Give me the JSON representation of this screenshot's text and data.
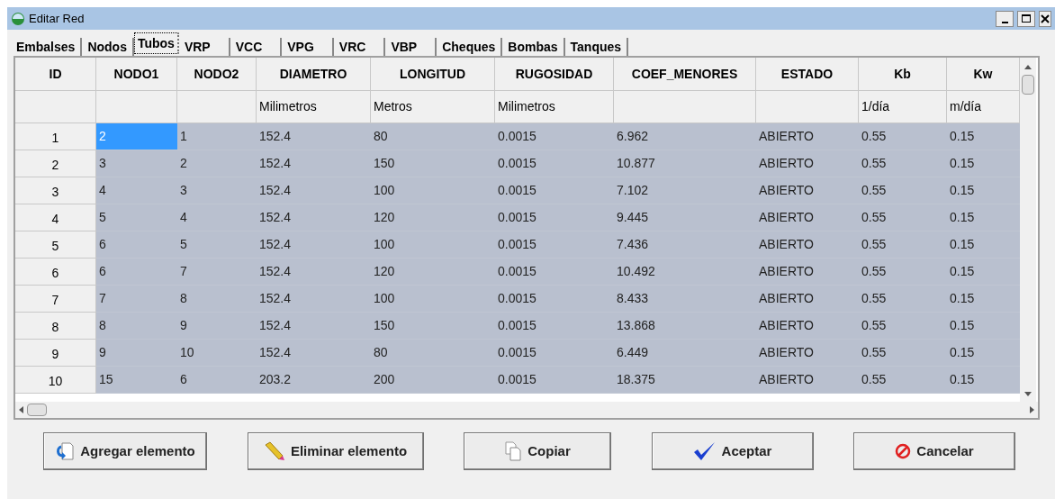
{
  "window": {
    "title": "Editar Red"
  },
  "tabs": [
    {
      "label": "Embalses",
      "selected": false
    },
    {
      "label": "Nodos",
      "selected": false
    },
    {
      "label": "Tubos",
      "selected": true
    },
    {
      "label": "VRP",
      "selected": false
    },
    {
      "label": "VCC",
      "selected": false
    },
    {
      "label": "VPG",
      "selected": false
    },
    {
      "label": "VRC",
      "selected": false
    },
    {
      "label": "VBP",
      "selected": false
    },
    {
      "label": "Cheques",
      "selected": false
    },
    {
      "label": "Bombas",
      "selected": false
    },
    {
      "label": "Tanques",
      "selected": false
    }
  ],
  "table": {
    "columns": [
      {
        "name": "ID"
      },
      {
        "name": "NODO1"
      },
      {
        "name": "NODO2"
      },
      {
        "name": "DIAMETRO",
        "unit": "Milimetros"
      },
      {
        "name": "LONGITUD",
        "unit": "Metros"
      },
      {
        "name": "RUGOSIDAD",
        "unit": "Milimetros"
      },
      {
        "name": "COEF_MENORES"
      },
      {
        "name": "ESTADO"
      },
      {
        "name": "Kb",
        "unit": "1/día"
      },
      {
        "name": "Kw",
        "unit": "m/día"
      }
    ],
    "rows": [
      {
        "selected": true,
        "cells": [
          {
            "text": "1",
            "selected": false
          },
          {
            "text": "2",
            "selected": true
          },
          {
            "text": "1",
            "selected": false
          },
          {
            "text": "152.4",
            "selected": false
          },
          {
            "text": "80",
            "selected": false
          },
          {
            "text": "0.0015",
            "selected": false
          },
          {
            "text": "6.962",
            "selected": false
          },
          {
            "text": "ABIERTO",
            "selected": false
          },
          {
            "text": "0.55",
            "selected": false
          },
          {
            "text": "0.15",
            "selected": false
          }
        ]
      },
      {
        "selected": true,
        "cells": [
          {
            "text": "2",
            "selected": false
          },
          {
            "text": "3",
            "selected": false
          },
          {
            "text": "2",
            "selected": false
          },
          {
            "text": "152.4",
            "selected": false
          },
          {
            "text": "150",
            "selected": false
          },
          {
            "text": "0.0015",
            "selected": false
          },
          {
            "text": "10.877",
            "selected": false
          },
          {
            "text": "ABIERTO",
            "selected": false
          },
          {
            "text": "0.55",
            "selected": false
          },
          {
            "text": "0.15",
            "selected": false
          }
        ]
      },
      {
        "selected": true,
        "cells": [
          {
            "text": "3",
            "selected": false
          },
          {
            "text": "4",
            "selected": false
          },
          {
            "text": "3",
            "selected": false
          },
          {
            "text": "152.4",
            "selected": false
          },
          {
            "text": "100",
            "selected": false
          },
          {
            "text": "0.0015",
            "selected": false
          },
          {
            "text": "7.102",
            "selected": false
          },
          {
            "text": "ABIERTO",
            "selected": false
          },
          {
            "text": "0.55",
            "selected": false
          },
          {
            "text": "0.15",
            "selected": false
          }
        ]
      },
      {
        "selected": true,
        "cells": [
          {
            "text": "4",
            "selected": false
          },
          {
            "text": "5",
            "selected": false
          },
          {
            "text": "4",
            "selected": false
          },
          {
            "text": "152.4",
            "selected": false
          },
          {
            "text": "120",
            "selected": false
          },
          {
            "text": "0.0015",
            "selected": false
          },
          {
            "text": "9.445",
            "selected": false
          },
          {
            "text": "ABIERTO",
            "selected": false
          },
          {
            "text": "0.55",
            "selected": false
          },
          {
            "text": "0.15",
            "selected": false
          }
        ]
      },
      {
        "selected": true,
        "cells": [
          {
            "text": "5",
            "selected": false
          },
          {
            "text": "6",
            "selected": false
          },
          {
            "text": "5",
            "selected": false
          },
          {
            "text": "152.4",
            "selected": false
          },
          {
            "text": "100",
            "selected": false
          },
          {
            "text": "0.0015",
            "selected": false
          },
          {
            "text": "7.436",
            "selected": false
          },
          {
            "text": "ABIERTO",
            "selected": false
          },
          {
            "text": "0.55",
            "selected": false
          },
          {
            "text": "0.15",
            "selected": false
          }
        ]
      },
      {
        "selected": true,
        "cells": [
          {
            "text": "6",
            "selected": false
          },
          {
            "text": "6",
            "selected": false
          },
          {
            "text": "7",
            "selected": false
          },
          {
            "text": "152.4",
            "selected": false
          },
          {
            "text": "120",
            "selected": false
          },
          {
            "text": "0.0015",
            "selected": false
          },
          {
            "text": "10.492",
            "selected": false
          },
          {
            "text": "ABIERTO",
            "selected": false
          },
          {
            "text": "0.55",
            "selected": false
          },
          {
            "text": "0.15",
            "selected": false
          }
        ]
      },
      {
        "selected": true,
        "cells": [
          {
            "text": "7",
            "selected": false
          },
          {
            "text": "7",
            "selected": false
          },
          {
            "text": "8",
            "selected": false
          },
          {
            "text": "152.4",
            "selected": false
          },
          {
            "text": "100",
            "selected": false
          },
          {
            "text": "0.0015",
            "selected": false
          },
          {
            "text": "8.433",
            "selected": false
          },
          {
            "text": "ABIERTO",
            "selected": false
          },
          {
            "text": "0.55",
            "selected": false
          },
          {
            "text": "0.15",
            "selected": false
          }
        ]
      },
      {
        "selected": true,
        "cells": [
          {
            "text": "8",
            "selected": false
          },
          {
            "text": "8",
            "selected": false
          },
          {
            "text": "9",
            "selected": false
          },
          {
            "text": "152.4",
            "selected": false
          },
          {
            "text": "150",
            "selected": false
          },
          {
            "text": "0.0015",
            "selected": false
          },
          {
            "text": "13.868",
            "selected": false
          },
          {
            "text": "ABIERTO",
            "selected": false
          },
          {
            "text": "0.55",
            "selected": false
          },
          {
            "text": "0.15",
            "selected": false
          }
        ]
      },
      {
        "selected": true,
        "cells": [
          {
            "text": "9",
            "selected": false
          },
          {
            "text": "9",
            "selected": false
          },
          {
            "text": "10",
            "selected": false
          },
          {
            "text": "152.4",
            "selected": false
          },
          {
            "text": "80",
            "selected": false
          },
          {
            "text": "0.0015",
            "selected": false
          },
          {
            "text": "6.449",
            "selected": false
          },
          {
            "text": "ABIERTO",
            "selected": false
          },
          {
            "text": "0.55",
            "selected": false
          },
          {
            "text": "0.15",
            "selected": false
          }
        ]
      },
      {
        "selected": true,
        "cells": [
          {
            "text": "10",
            "selected": false
          },
          {
            "text": "15",
            "selected": false
          },
          {
            "text": "6",
            "selected": false
          },
          {
            "text": "203.2",
            "selected": false
          },
          {
            "text": "200",
            "selected": false
          },
          {
            "text": "0.0015",
            "selected": false
          },
          {
            "text": "18.375",
            "selected": false
          },
          {
            "text": "ABIERTO",
            "selected": false
          },
          {
            "text": "0.55",
            "selected": false
          },
          {
            "text": "0.15",
            "selected": false
          }
        ]
      }
    ]
  },
  "buttons": [
    {
      "label": "Agregar elemento",
      "kind": "add"
    },
    {
      "label": "Eliminar elemento",
      "kind": "delete"
    },
    {
      "label": "Copiar",
      "kind": "copy"
    },
    {
      "label": "Aceptar",
      "kind": "accept"
    },
    {
      "label": "Cancelar",
      "kind": "cancel"
    }
  ]
}
